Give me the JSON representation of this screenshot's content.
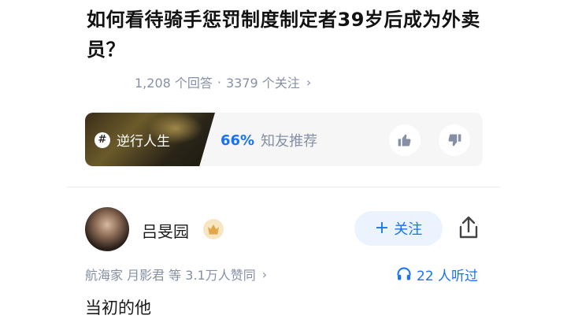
{
  "question": {
    "title": "如何看待骑手惩罚制度制定者39岁后成为外卖员？",
    "answers_count": "1,208 个回答",
    "separator": "·",
    "followers_count": "3379 个关注",
    "meta_chevron": "›"
  },
  "topic_card": {
    "tag_icon": "#",
    "tag_label": "逆行人生",
    "recommend_percent": "66%",
    "recommend_text": "知友推荐",
    "upvote_icon": "thumbs-up-icon",
    "downvote_icon": "thumbs-down-icon"
  },
  "answer": {
    "author_name": "吕旻园",
    "badge_icon": "crown-badge-icon",
    "follow_plus": "+",
    "follow_label": "关注",
    "share_icon": "share-icon",
    "endorsement_text": "航海家 月影君 等 3.1万人赞同",
    "endorsement_chevron": "›",
    "listen_text": "22 人听过",
    "body_first_line": "当初的他"
  },
  "colors": {
    "accent": "#1772f6",
    "muted": "#8590a6",
    "follow_bg": "#ebf3ff"
  }
}
